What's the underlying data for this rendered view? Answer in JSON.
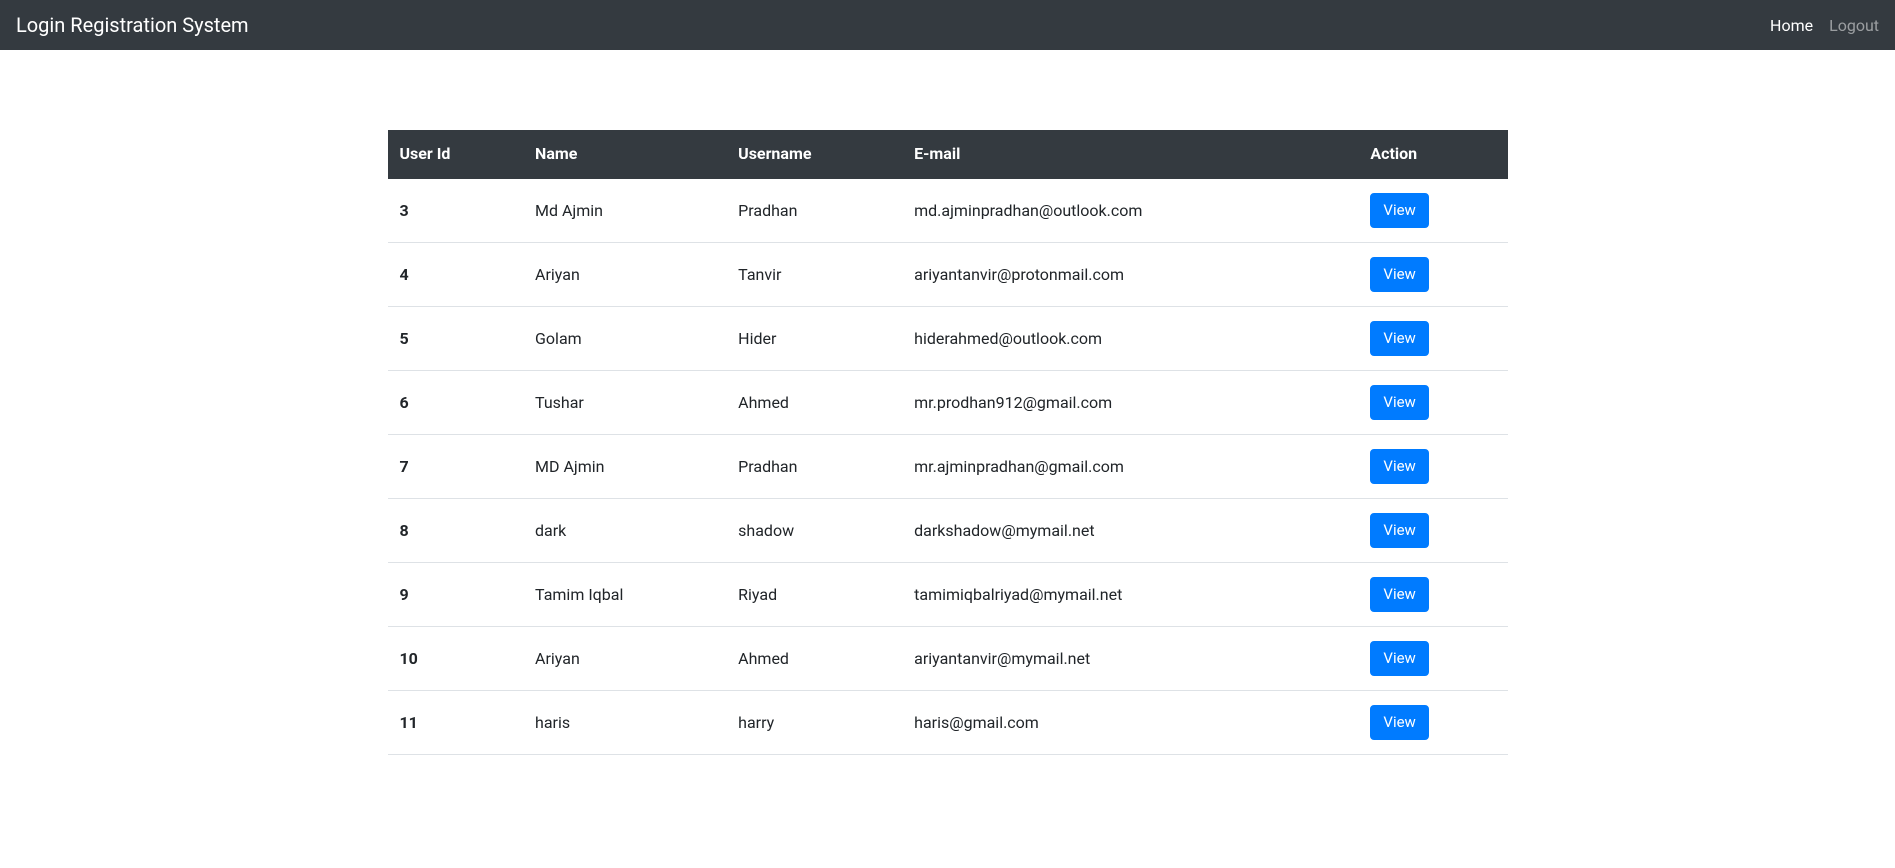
{
  "navbar": {
    "brand": "Login Registration System",
    "links": {
      "home": "Home",
      "logout": "Logout"
    }
  },
  "table": {
    "headers": {
      "user_id": "User Id",
      "name": "Name",
      "username": "Username",
      "email": "E-mail",
      "action": "Action"
    },
    "action_label": "View",
    "rows": [
      {
        "id": "3",
        "name": "Md Ajmin",
        "username": "Pradhan",
        "email": "md.ajminpradhan@outlook.com"
      },
      {
        "id": "4",
        "name": "Ariyan",
        "username": "Tanvir",
        "email": "ariyantanvir@protonmail.com"
      },
      {
        "id": "5",
        "name": "Golam",
        "username": "Hider",
        "email": "hiderahmed@outlook.com"
      },
      {
        "id": "6",
        "name": "Tushar",
        "username": "Ahmed",
        "email": "mr.prodhan912@gmail.com"
      },
      {
        "id": "7",
        "name": "MD Ajmin",
        "username": "Pradhan",
        "email": "mr.ajminpradhan@gmail.com"
      },
      {
        "id": "8",
        "name": "dark",
        "username": "shadow",
        "email": "darkshadow@mymail.net"
      },
      {
        "id": "9",
        "name": "Tamim Iqbal",
        "username": "Riyad",
        "email": "tamimiqbalriyad@mymail.net"
      },
      {
        "id": "10",
        "name": "Ariyan",
        "username": "Ahmed",
        "email": "ariyantanvir@mymail.net"
      },
      {
        "id": "11",
        "name": "haris",
        "username": "harry",
        "email": "haris@gmail.com"
      }
    ]
  }
}
